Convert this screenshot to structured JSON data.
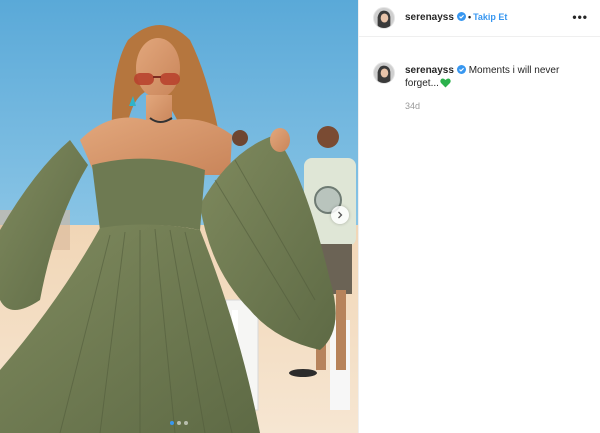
{
  "post": {
    "username": "serenayss",
    "follow_label": "Takip Et",
    "separator": "•",
    "more_label": "•••",
    "caption": "Moments i will never forget...",
    "caption_emoji": "green-heart-icon",
    "timestamp": "34d",
    "carousel": {
      "slides": 3,
      "active_slide": 1
    }
  },
  "icons": {
    "verified": "verified-badge-icon",
    "next": "chevron-right-icon",
    "more": "more-options-icon"
  },
  "colors": {
    "link_blue": "#3897f0",
    "verified_blue": "#3897f0",
    "heart_green": "#2bb14c",
    "muted_text": "#999999"
  }
}
